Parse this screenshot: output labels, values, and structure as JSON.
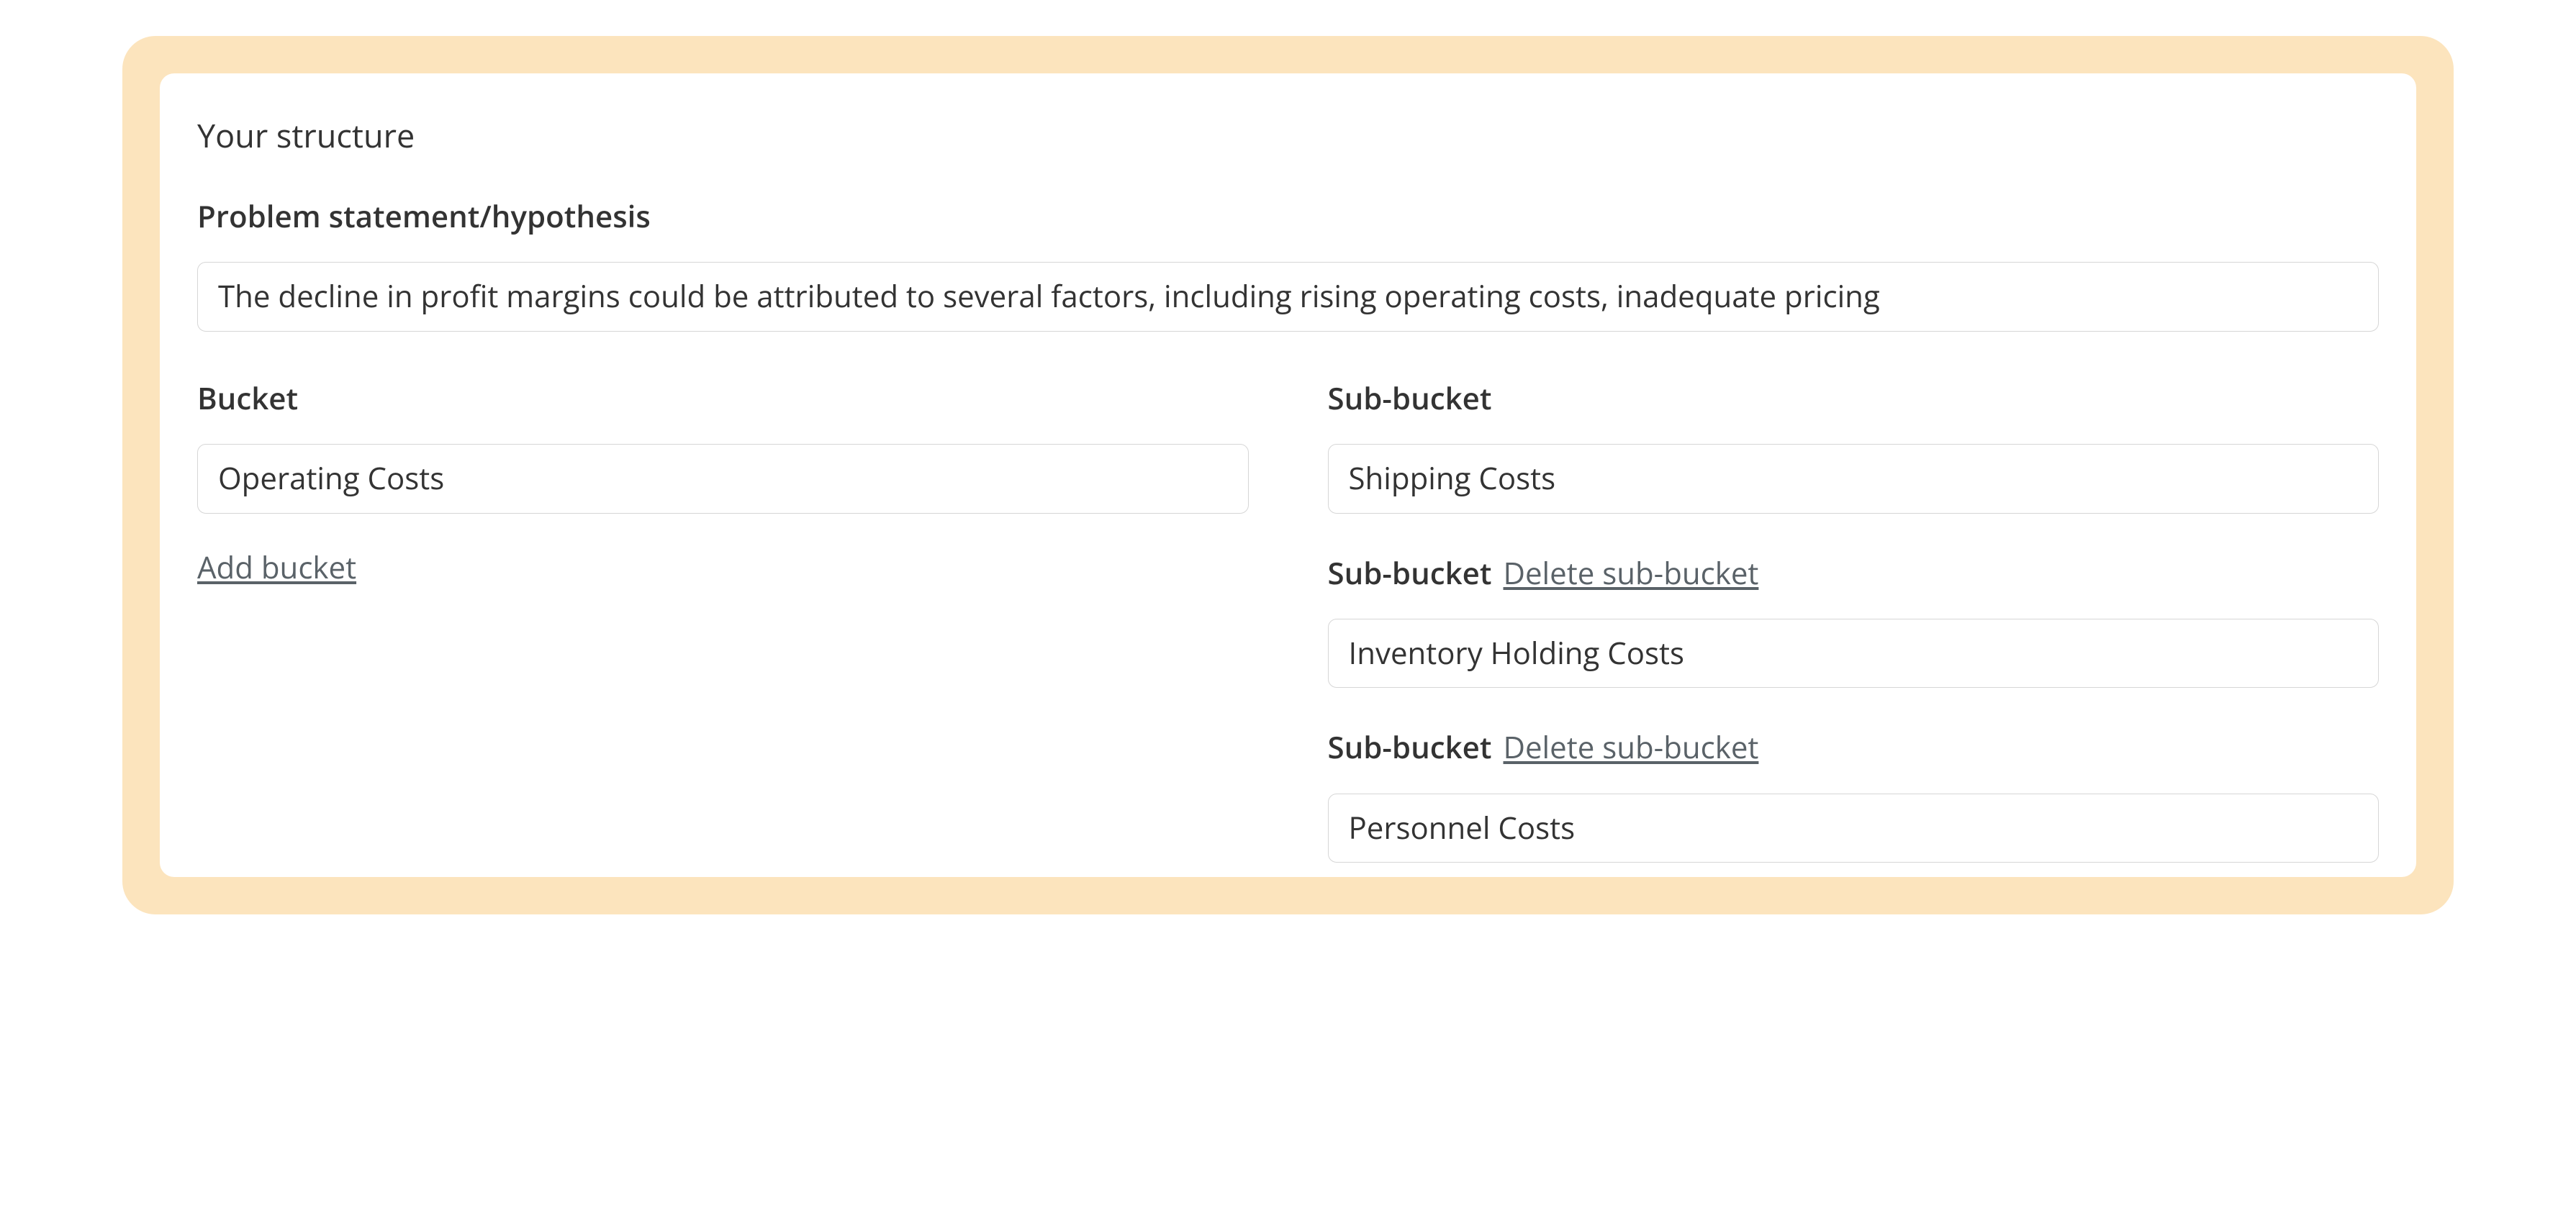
{
  "section_title": "Your structure",
  "problem": {
    "label": "Problem statement/hypothesis",
    "value": "The decline in profit margins could be attributed to several factors, including rising operating costs, inadequate pricing"
  },
  "bucket_column": {
    "label": "Bucket",
    "value": "Operating Costs",
    "add_label": "Add bucket"
  },
  "sub_buckets": [
    {
      "label": "Sub-bucket",
      "delete_label": null,
      "value": "Shipping Costs"
    },
    {
      "label": "Sub-bucket",
      "delete_label": "Delete sub-bucket",
      "value": "Inventory Holding Costs"
    },
    {
      "label": "Sub-bucket",
      "delete_label": "Delete sub-bucket",
      "value": "Personnel Costs"
    }
  ]
}
